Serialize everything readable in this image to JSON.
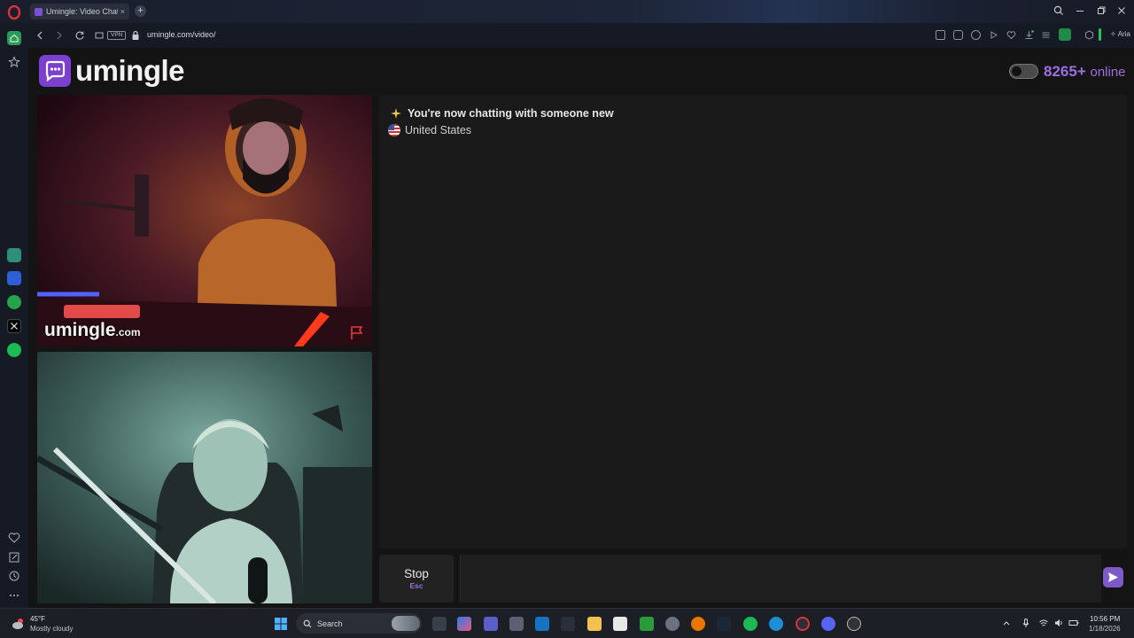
{
  "browser": {
    "tab_title": "Umingle: Video Chat",
    "tab_close": "×",
    "new_tab": "+",
    "url": "umingle.com/video/",
    "vpn_label": "VPN",
    "ai_label": "Aria"
  },
  "site": {
    "brand": "umingle",
    "online_count": "8265+",
    "online_label": "online",
    "accent_color": "#9b6fe0"
  },
  "video": {
    "watermark_main": "umingle",
    "watermark_suffix": ".com"
  },
  "chat": {
    "message": "You're now chatting with someone new",
    "country": "United States",
    "stop_label": "Stop",
    "stop_key": "Esc",
    "input_value": ""
  },
  "taskbar": {
    "temperature": "45°F",
    "weather": "Mostly cloudy",
    "search_label": "Search",
    "time": "10:56 PM",
    "date": "1/18/2026"
  }
}
